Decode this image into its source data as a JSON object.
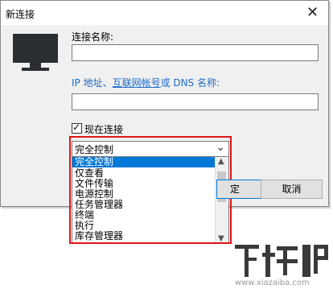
{
  "window": {
    "title": "新连接",
    "close_glyph": "✕"
  },
  "form": {
    "connection_name_label": "连接名称:",
    "connection_name_value": "",
    "address_label_prefix": "IP 地址、",
    "address_label_link": "互联网帐号",
    "address_label_suffix": "或 DNS 名称:",
    "address_value": "",
    "connect_now_label": "现在连接",
    "connect_now_checked": true
  },
  "mode_select": {
    "selected": "完全控制",
    "options": [
      "完全控制",
      "仅查看",
      "文件传输",
      "电源控制",
      "任务管理器",
      "终端",
      "执行",
      "库存管理器"
    ]
  },
  "buttons": {
    "ok_partial": "定",
    "cancel": "取消"
  },
  "watermark": {
    "logo_text": "下载吧",
    "url": "www.xiazaiba.com"
  },
  "icons": {
    "monitor": "monitor-icon",
    "dropdown_arrow": "chevron-down-icon",
    "scroll_up": "scroll-up-icon",
    "scroll_down": "scroll-down-icon"
  },
  "colors": {
    "highlight": "#0078d7",
    "red_outline": "#e01414",
    "link": "#1b6ac9"
  }
}
